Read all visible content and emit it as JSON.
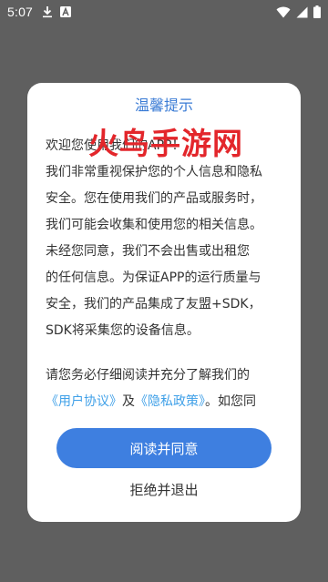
{
  "status_bar": {
    "time": "5:07",
    "left_icons": [
      "download-icon",
      "a-badge-icon"
    ],
    "right_icons": [
      "wifi-icon",
      "signal-icon",
      "battery-icon"
    ]
  },
  "dialog": {
    "title": "温馨提示",
    "watermark": "火鸟手游网",
    "paragraph1_lines": [
      "欢迎您使用我们的APP！",
      "我们非常重视保护您的个人信息和隐私",
      "安全。您在使用我们的产品或服务时，",
      "我们可能会收集和使用您的相关信息。",
      "未经您同意，我们不会出售或出租您",
      "的任何信息。为保证APP的运行质量与",
      "安全，我们的产品集成了友盟+SDK，",
      "SDK将采集您的设备信息。"
    ],
    "paragraph2_line1": "请您务必仔细阅读并充分了解我们的",
    "user_agreement_link": "《用户协议》",
    "and_text": "及",
    "privacy_policy_link": "《隐私政策》",
    "paragraph2_tail": "。如您同",
    "agree_button": "阅读并同意",
    "decline_button": "拒绝并退出"
  },
  "colors": {
    "backdrop": "#5f5f5f",
    "title": "#3a7bd5",
    "link": "#3fa0e8",
    "button": "#3e7fe0",
    "watermark": "#e3262b"
  }
}
